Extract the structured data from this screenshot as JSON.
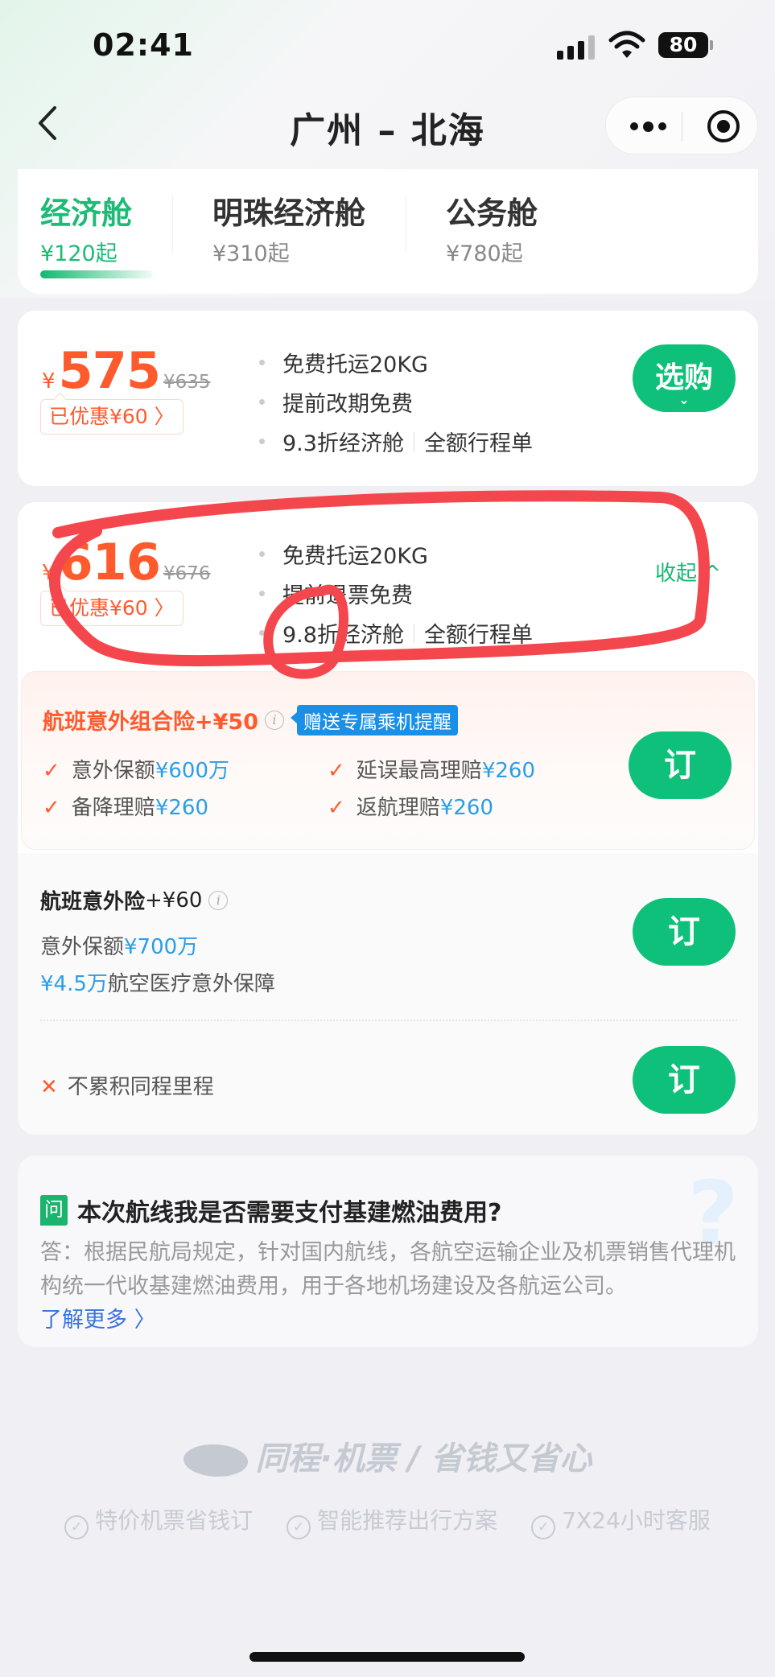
{
  "status_bar": {
    "time": "02:41",
    "battery": "80"
  },
  "nav": {
    "title": "广州 – 北海"
  },
  "tabs": [
    {
      "name": "经济舱",
      "price": "¥120起",
      "active": true
    },
    {
      "name": "明珠经济舱",
      "price": "¥310起",
      "active": false
    },
    {
      "name": "公务舱",
      "price": "¥780起",
      "active": false
    }
  ],
  "fares": [
    {
      "yen": "¥",
      "price": "575",
      "original": "¥635",
      "discount": "已优惠¥60 〉",
      "features": [
        "免费托运20KG",
        "提前改期免费"
      ],
      "feature3_a": "9.3折经济舱",
      "feature3_b": "全额行程单",
      "button": "选购",
      "button_chev": "⌄"
    },
    {
      "yen": "¥",
      "price": "616",
      "original": "¥676",
      "discount": "已优惠¥60 〉",
      "features": [
        "免费托运20KG",
        "提前退票免费"
      ],
      "feature3_a": "9.8折经济舱",
      "feature3_b": "全额行程单",
      "collapse": "收起 ^"
    }
  ],
  "insurance_combo": {
    "title": "航班意外组合险+¥50",
    "info": "i",
    "badge": "赠送专属乘机提醒",
    "items": [
      {
        "check": "✓",
        "label": "意外保额",
        "value": "¥600万"
      },
      {
        "check": "✓",
        "label": "延误最高理赔",
        "value": "¥260"
      },
      {
        "check": "✓",
        "label": "备降理赔",
        "value": "¥260"
      },
      {
        "check": "✓",
        "label": "返航理赔",
        "value": "¥260"
      }
    ],
    "button": "订"
  },
  "insurance_basic": {
    "title_bold": "航班意外险",
    "title_price": "+¥60",
    "info": "i",
    "line1_label": "意外保额",
    "line1_value": "¥700万",
    "line2_value": "¥4.5万",
    "line2_label": "航空医疗意外保障",
    "button": "订"
  },
  "no_insurance": {
    "mark": "✕",
    "label": "不累积同程里程",
    "button": "订"
  },
  "faq": {
    "q_icon": "问",
    "question": "本次航线我是否需要支付基建燃油费用?",
    "answer": "答：根据民航局规定，针对国内航线，各航空运输企业及机票销售代理机构统一代收基建燃油费用，用于各地机场建设及各航运公司。",
    "more": "了解更多 〉",
    "watermark": "?"
  },
  "footer": {
    "brand": "同程·机票 / 省钱又省心",
    "features": [
      "特价机票省钱订",
      "智能推荐出行方案",
      "7X24小时客服"
    ],
    "check": "✓"
  },
  "colors": {
    "accent_green": "#0fc07a",
    "price_orange": "#ff5a2d",
    "link_blue": "#2a9ee6",
    "annotation_red": "#f4474d"
  }
}
